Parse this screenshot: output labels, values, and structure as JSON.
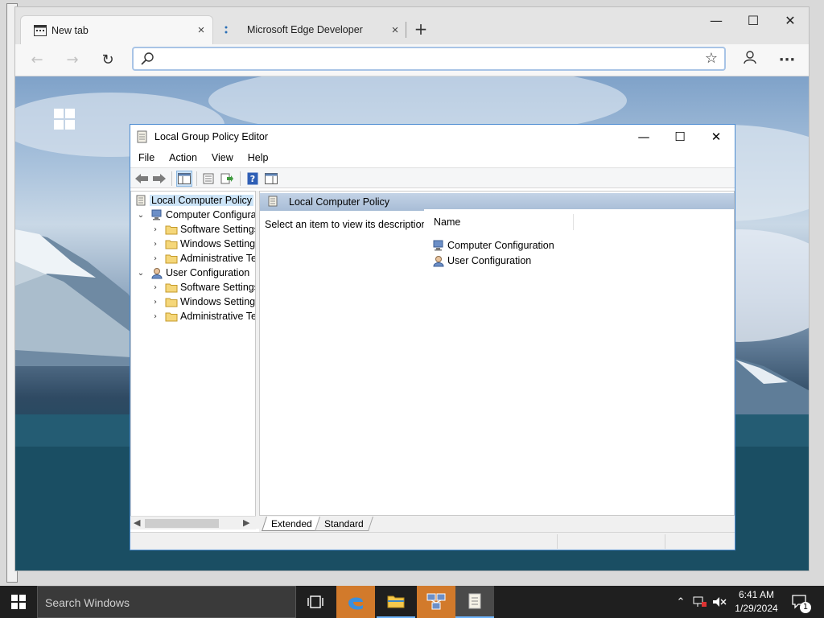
{
  "browser": {
    "tabs": [
      {
        "label": "New tab",
        "close": "×"
      },
      {
        "label": "Microsoft Edge Developer",
        "close": "×"
      }
    ],
    "new_tab": "+",
    "window_controls": {
      "minimize": "—",
      "maximize": "☐",
      "close": "✕"
    },
    "nav": {
      "back": "←",
      "forward": "→",
      "refresh": "↻"
    },
    "address": {
      "value": "",
      "placeholder": ""
    },
    "favorite": "☆",
    "more": "···"
  },
  "gpe": {
    "title": "Local Group Policy Editor",
    "window_controls": {
      "minimize": "—",
      "maximize": "☐",
      "close": "✕"
    },
    "menu": [
      "File",
      "Action",
      "View",
      "Help"
    ],
    "tree": {
      "root": "Local Computer Policy",
      "computer": "Computer Configura",
      "computer_children": [
        "Software Settings",
        "Windows Setting",
        "Administrative Te"
      ],
      "user": "User Configuration",
      "user_children": [
        "Software Settings",
        "Windows Setting",
        "Administrative Te"
      ]
    },
    "right": {
      "header": "Local Computer Policy",
      "description": "Select an item to view its description.",
      "column_name": "Name",
      "items": [
        "Computer Configuration",
        "User Configuration"
      ]
    },
    "view_tabs": [
      "Extended",
      "Standard"
    ]
  },
  "taskbar": {
    "search_placeholder": "Search Windows",
    "clock_time": "6:41 AM",
    "clock_date": "1/29/2024",
    "notification_count": "1"
  },
  "colors": {
    "accent": "#4a8ad0",
    "taskbar_highlight": "#d27a2b",
    "taskbar": "#1f1f1f"
  }
}
